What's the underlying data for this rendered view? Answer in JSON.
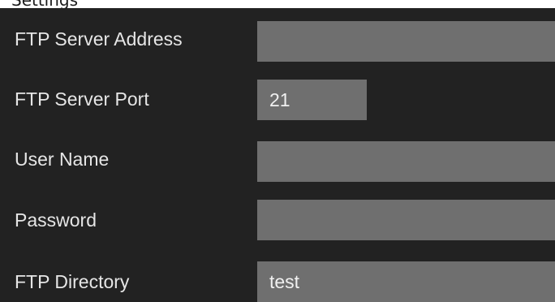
{
  "top_strip": {
    "text": "Settings"
  },
  "form": {
    "fields": [
      {
        "label": "FTP Server Address",
        "value": ""
      },
      {
        "label": "FTP Server Port",
        "value": "21"
      },
      {
        "label": "User Name",
        "value": ""
      },
      {
        "label": "Password",
        "value": ""
      },
      {
        "label": "FTP Directory",
        "value": "test"
      }
    ]
  },
  "colors": {
    "panel_background": "#222222",
    "input_background": "#6f6f6f",
    "label_text": "#e6e6e6",
    "input_text": "#f0f0f0"
  }
}
